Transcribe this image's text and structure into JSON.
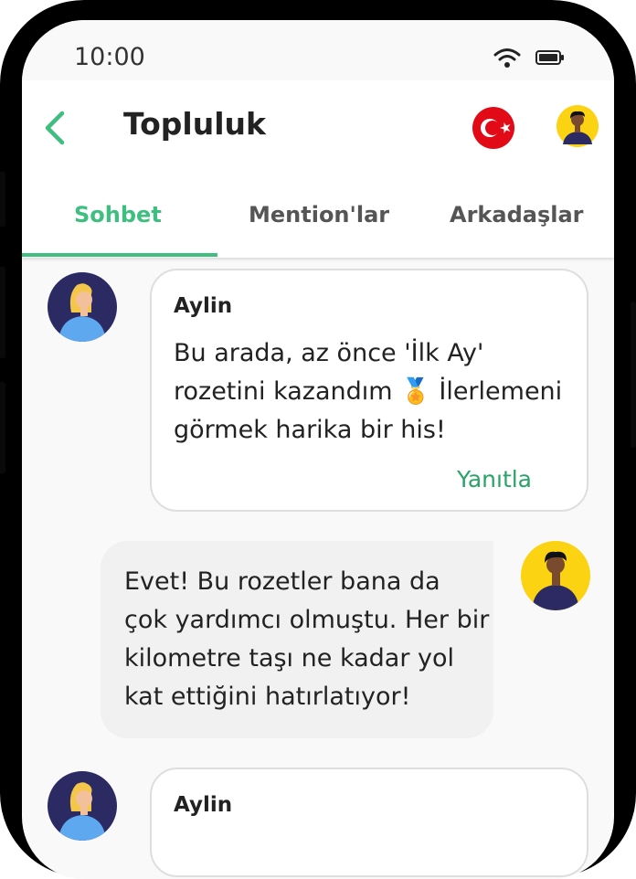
{
  "status_bar": {
    "time": "10:00"
  },
  "header": {
    "title": "Topluluk",
    "tabs": [
      {
        "label": "Sohbet",
        "active": true
      },
      {
        "label": "Mention'lar",
        "active": false
      },
      {
        "label": "Arkadaşlar",
        "active": false
      }
    ]
  },
  "messages": [
    {
      "sender": "Aylin",
      "text": "Bu arada, az önce 'İlk Ay' rozetini kazandım 🏅 İlerlemeni görmek harika bir his!",
      "reply_label": "Yanıtla"
    },
    {
      "text": "Evet! Bu rozetler bana da çok yardımcı olmuştu. Her bir kilometre taşı ne kadar yol kat ettiğini hatırlatıyor!"
    },
    {
      "sender": "Aylin"
    }
  ],
  "colors": {
    "accent": "#3fbf7f",
    "reply_link": "#2aa368",
    "outgoing_bubble": "#f1f1f1",
    "avatar_dark": "#2b2a63",
    "avatar_yellow": "#fbd312",
    "flag_red": "#e30a17"
  },
  "icons": [
    "back-arrow-icon",
    "wifi-icon",
    "battery-icon",
    "turkey-flag-icon",
    "profile-avatar-icon"
  ]
}
